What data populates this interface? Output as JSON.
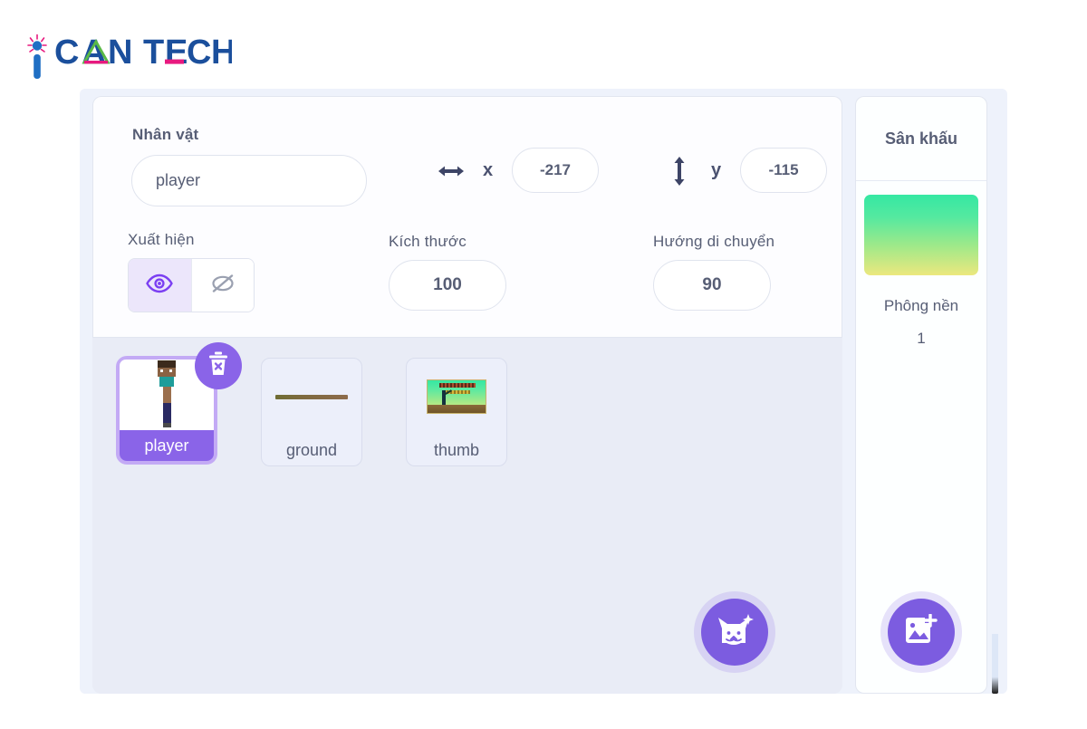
{
  "brand": {
    "name": "ICANTECH",
    "word_can": "CAN",
    "word_tech": "TECH",
    "colors": {
      "blue": "#1b4f9c",
      "accent_blue": "#1f6fc4",
      "pink": "#e8197f",
      "green": "#5ab947"
    }
  },
  "sprite_info": {
    "title": "Nhân vật",
    "name_value": "player",
    "name_placeholder": "player",
    "x_label": "x",
    "x_value": "-217",
    "y_label": "y",
    "y_value": "-115",
    "visibility_label": "Xuất hiện",
    "size_label": "Kích thước",
    "size_value": "100",
    "direction_label": "Hướng di chuyển",
    "direction_value": "90",
    "show_icon": "eye-icon",
    "hide_icon": "eye-slash-icon",
    "x_icon": "horizontal-arrow-icon",
    "y_icon": "vertical-arrow-icon"
  },
  "sprites": [
    {
      "name": "player",
      "selected": true,
      "thumb": "steve-character"
    },
    {
      "name": "ground",
      "selected": false,
      "thumb": "ground-bar"
    },
    {
      "name": "thumb",
      "selected": false,
      "thumb": "minecraft-scene"
    }
  ],
  "delete_badge": {
    "icon": "trash-delete-icon"
  },
  "stage": {
    "title": "Sân khấu",
    "backdrop_label": "Phông nền",
    "backdrop_count": "1",
    "backdrop_thumb": "green-yellow-gradient"
  },
  "fabs": {
    "add_sprite": {
      "icon": "cat-plus-icon",
      "color": "#7c5ce0"
    },
    "add_backdrop": {
      "icon": "image-plus-icon",
      "color": "#7c5ce0"
    }
  }
}
